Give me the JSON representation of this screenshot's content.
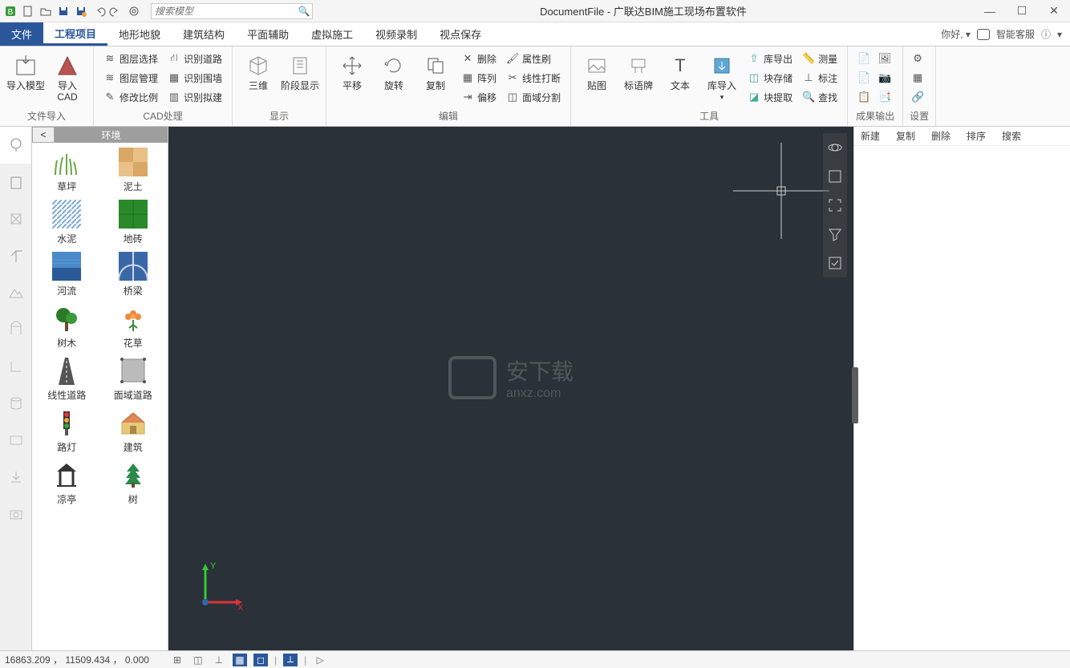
{
  "title": "DocumentFile - 广联达BIM施工现场布置软件",
  "qat_icons": [
    "logo",
    "new",
    "open",
    "save",
    "save-as",
    "undo",
    "redo",
    "settings"
  ],
  "search_placeholder": "搜索模型",
  "greeting": "你好,",
  "smart_service": "智能客服",
  "menu": {
    "file": "文件",
    "tabs": [
      "工程项目",
      "地形地貌",
      "建筑结构",
      "平面辅助",
      "虚拟施工",
      "视频录制",
      "视点保存"
    ],
    "active_tab": "工程项目"
  },
  "ribbon": {
    "groups": [
      {
        "label": "文件导入",
        "big": [
          {
            "id": "import-model",
            "label": "导入模型"
          },
          {
            "id": "import-cad",
            "label": "导入CAD"
          }
        ]
      },
      {
        "label": "CAD处理",
        "cols": [
          [
            {
              "id": "layer-select",
              "label": "图层选择"
            },
            {
              "id": "layer-manage",
              "label": "图层管理"
            },
            {
              "id": "modify-scale",
              "label": "修改比例"
            }
          ],
          [
            {
              "id": "id-road",
              "label": "识别道路"
            },
            {
              "id": "id-wall",
              "label": "识别围墙"
            },
            {
              "id": "id-build",
              "label": "识别拟建"
            }
          ]
        ]
      },
      {
        "label": "显示",
        "big": [
          {
            "id": "view-3d",
            "label": "三维"
          },
          {
            "id": "phase-display",
            "label": "阶段显示"
          }
        ]
      },
      {
        "label": "编辑",
        "big": [
          {
            "id": "move",
            "label": "平移"
          },
          {
            "id": "rotate",
            "label": "旋转"
          },
          {
            "id": "copy",
            "label": "复制"
          }
        ],
        "cols": [
          [
            {
              "id": "delete",
              "label": "删除"
            },
            {
              "id": "array",
              "label": "阵列"
            },
            {
              "id": "offset",
              "label": "偏移"
            }
          ],
          [
            {
              "id": "prop-brush",
              "label": "属性刷"
            },
            {
              "id": "line-break",
              "label": "线性打断"
            },
            {
              "id": "face-split",
              "label": "面域分割"
            }
          ]
        ]
      },
      {
        "label": "工具",
        "big": [
          {
            "id": "paste-img",
            "label": "贴图"
          },
          {
            "id": "sign",
            "label": "标语牌"
          },
          {
            "id": "text",
            "label": "文本"
          },
          {
            "id": "lib-import",
            "label": "库导入"
          }
        ],
        "cols": [
          [
            {
              "id": "lib-export",
              "label": "库导出"
            },
            {
              "id": "block-save",
              "label": "块存储"
            },
            {
              "id": "block-extract",
              "label": "块提取"
            }
          ],
          [
            {
              "id": "measure",
              "label": "测量"
            },
            {
              "id": "annotate",
              "label": "标注"
            },
            {
              "id": "find",
              "label": "查找"
            }
          ]
        ]
      },
      {
        "label": "成果输出",
        "icons": 6
      },
      {
        "label": "设置",
        "icons": 2
      }
    ]
  },
  "left_tabs": [
    {
      "id": "tree",
      "icon": "tree",
      "active": true
    },
    {
      "id": "building",
      "icon": "building"
    },
    {
      "id": "frame",
      "icon": "frame"
    },
    {
      "id": "crane",
      "icon": "crane"
    },
    {
      "id": "mountain",
      "icon": "mountain"
    },
    {
      "id": "gate",
      "icon": "gate"
    },
    {
      "id": "lshape",
      "icon": "lshape"
    },
    {
      "id": "cylinder",
      "icon": "cylinder"
    },
    {
      "id": "panel",
      "icon": "panel"
    },
    {
      "id": "download",
      "icon": "download"
    },
    {
      "id": "camera",
      "icon": "camera"
    }
  ],
  "palette": {
    "title": "环境",
    "items": [
      {
        "id": "grass",
        "label": "草坪",
        "thumb": "grass"
      },
      {
        "id": "soil",
        "label": "泥土",
        "thumb": "soil"
      },
      {
        "id": "cement",
        "label": "水泥",
        "thumb": "cement"
      },
      {
        "id": "tile",
        "label": "地砖",
        "thumb": "tile"
      },
      {
        "id": "river",
        "label": "河流",
        "thumb": "river"
      },
      {
        "id": "bridge",
        "label": "桥梁",
        "thumb": "bridge"
      },
      {
        "id": "trees",
        "label": "树木",
        "thumb": "trees"
      },
      {
        "id": "flower",
        "label": "花草",
        "thumb": "flower"
      },
      {
        "id": "line-road",
        "label": "线性道路",
        "thumb": "lineroad"
      },
      {
        "id": "area-road",
        "label": "面域道路",
        "thumb": "arearoad"
      },
      {
        "id": "lamp",
        "label": "路灯",
        "thumb": "lamp"
      },
      {
        "id": "house",
        "label": "建筑",
        "thumb": "house"
      },
      {
        "id": "pavilion",
        "label": "凉亭",
        "thumb": "pavilion"
      },
      {
        "id": "tree2",
        "label": "树",
        "thumb": "tree2"
      }
    ]
  },
  "right_panel": {
    "tabs": [
      "新建",
      "复制",
      "删除",
      "排序",
      "搜索"
    ]
  },
  "watermark": {
    "text": "安下载",
    "sub": "anxz.com"
  },
  "axis": {
    "x": "X",
    "y": "Y"
  },
  "status": {
    "coords": "16863.209 ， 11509.434 ， 0.000"
  }
}
